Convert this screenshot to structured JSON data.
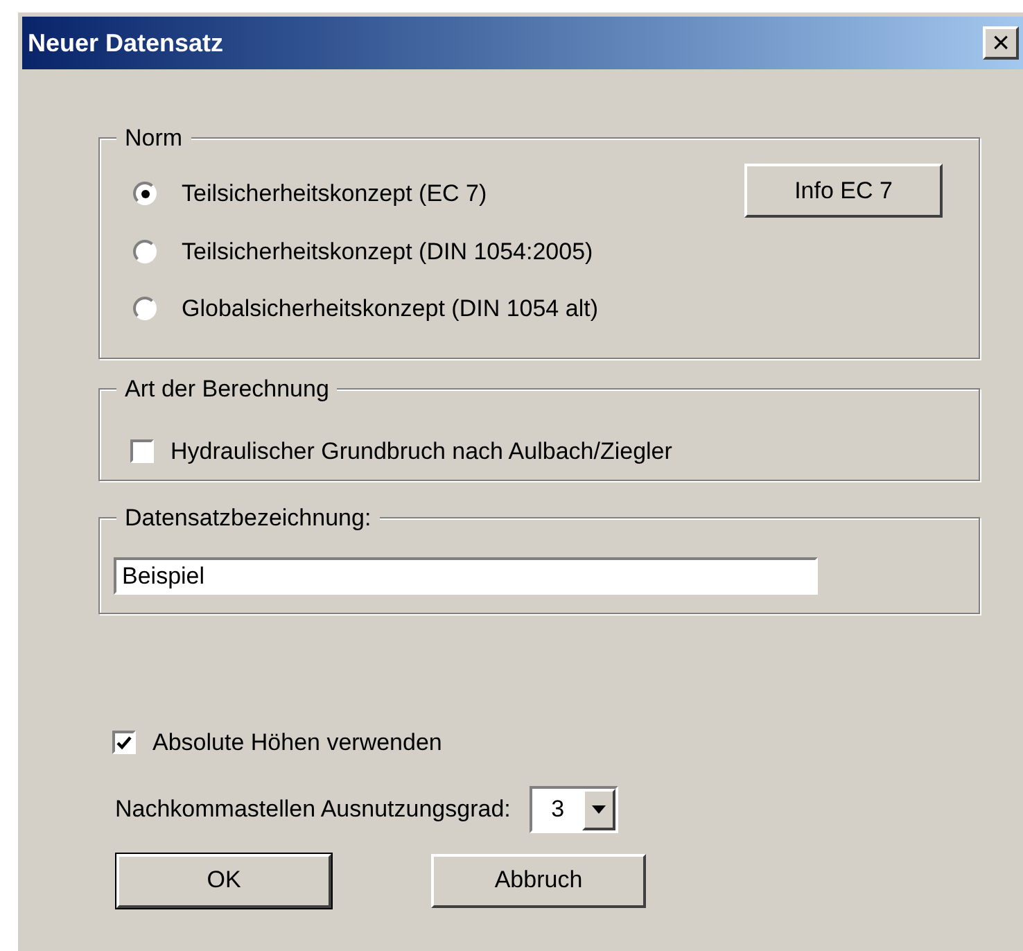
{
  "window": {
    "title": "Neuer Datensatz",
    "close": "×"
  },
  "norm": {
    "legend": "Norm",
    "options": [
      {
        "label": "Teilsicherheitskonzept (EC 7)",
        "selected": true
      },
      {
        "label": "Teilsicherheitskonzept (DIN 1054:2005)",
        "selected": false
      },
      {
        "label": "Globalsicherheitskonzept (DIN 1054 alt)",
        "selected": false
      }
    ],
    "info_button": "Info EC 7"
  },
  "berechnung": {
    "legend": "Art der Berechnung",
    "checkbox": {
      "label": "Hydraulischer Grundbruch nach Aulbach/Ziegler",
      "checked": false
    }
  },
  "bezeichnung": {
    "legend": "Datensatzbezeichnung:",
    "value": "Beispiel"
  },
  "absolute_hoehen": {
    "label": "Absolute Höhen verwenden",
    "checked": true
  },
  "nachkommastellen": {
    "label": "Nachkommastellen Ausnutzungsgrad:",
    "value": "3"
  },
  "buttons": [
    {
      "label": "OK",
      "default": true
    },
    {
      "label": "Abbruch",
      "default": false
    }
  ]
}
